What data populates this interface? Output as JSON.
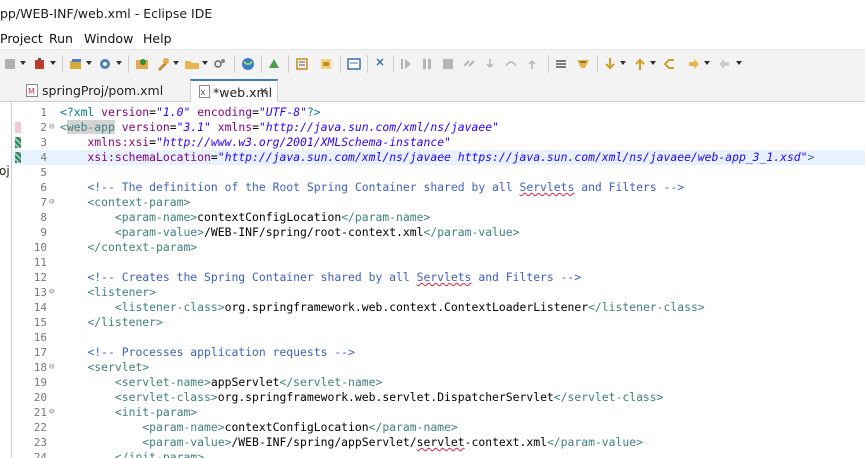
{
  "window": {
    "title": "pp/WEB-INF/web.xml - Eclipse IDE"
  },
  "menu": [
    {
      "label": "Project"
    },
    {
      "label": "Run"
    },
    {
      "label": "Window"
    },
    {
      "label": "Help"
    }
  ],
  "toolbar": {
    "icons": [
      "stop-icon",
      "debug-icon",
      "new-wizard-icon",
      "run-config-icon",
      "open-type-icon",
      "search-icon",
      "open-folder-icon",
      "tool-icon",
      "globe-icon",
      "run-server-icon",
      "outline-icon",
      "annotation-icon",
      "console-icon",
      "pin-icon",
      "resume-icon",
      "suspend-icon",
      "terminate-icon",
      "disconnect-icon",
      "step-into-icon",
      "step-over-icon",
      "step-return-icon",
      "task-list-icon",
      "bookmark-icon",
      "next-annotation-icon",
      "prev-annotation-icon",
      "back-icon",
      "forward-icon",
      "history-icon"
    ]
  },
  "tabs": [
    {
      "label": "springProj/pom.xml",
      "icon": "maven-pom-icon",
      "active": false
    },
    {
      "label": "*web.xml",
      "icon": "xml-file-icon",
      "active": true,
      "close": "✕"
    }
  ],
  "left_panel": {
    "fragment": "oj"
  },
  "editor": {
    "current_line": 4,
    "lines": [
      {
        "n": "1",
        "fold": "",
        "segments": [
          {
            "c": "k-pi",
            "t": "<?xml "
          },
          {
            "c": "k-attr",
            "t": "version"
          },
          {
            "c": "k-txt",
            "t": "="
          },
          {
            "c": "k-val",
            "t": "\"1.0\""
          },
          {
            "c": "k-txt",
            "t": " "
          },
          {
            "c": "k-attr",
            "t": "encoding"
          },
          {
            "c": "k-txt",
            "t": "="
          },
          {
            "c": "k-val",
            "t": "\"UTF-8\""
          },
          {
            "c": "k-pi",
            "t": "?>"
          }
        ]
      },
      {
        "n": "2",
        "fold": "⊖",
        "segments": [
          {
            "c": "k-tag",
            "t": "<"
          },
          {
            "c": "k-tag hl",
            "t": "web-app"
          },
          {
            "c": "k-txt",
            "t": " "
          },
          {
            "c": "k-attr",
            "t": "version"
          },
          {
            "c": "k-txt",
            "t": "="
          },
          {
            "c": "k-val",
            "t": "\"3.1\""
          },
          {
            "c": "k-txt",
            "t": " "
          },
          {
            "c": "k-attr",
            "t": "xmlns"
          },
          {
            "c": "k-txt",
            "t": "="
          },
          {
            "c": "k-val",
            "t": "\"http://java.sun.com/xml/ns/javaee\""
          }
        ]
      },
      {
        "n": "3",
        "fold": "",
        "segments": [
          {
            "c": "k-txt",
            "t": "    "
          },
          {
            "c": "k-attr",
            "t": "xmlns:xsi"
          },
          {
            "c": "k-txt",
            "t": "="
          },
          {
            "c": "k-val",
            "t": "\"http://www.w3.org/2001/XMLSchema-instance\""
          }
        ]
      },
      {
        "n": "4",
        "fold": "",
        "segments": [
          {
            "c": "k-txt",
            "t": "    "
          },
          {
            "c": "k-attr",
            "t": "xsi:schemaLocation"
          },
          {
            "c": "k-txt",
            "t": "="
          },
          {
            "c": "k-val",
            "t": "\"http://java.sun.com/xml/ns/javaee https://java.sun.com/xml/ns/javaee/web-app_3_1.xsd\""
          },
          {
            "c": "k-tag",
            "t": ">"
          }
        ]
      },
      {
        "n": "5",
        "fold": "",
        "segments": []
      },
      {
        "n": "6",
        "fold": "",
        "segments": [
          {
            "c": "k-txt",
            "t": "    "
          },
          {
            "c": "k-cmt",
            "t": "<!-- The definition of the Root Spring Container shared by all "
          },
          {
            "c": "k-cmt sq",
            "t": "Servlets"
          },
          {
            "c": "k-cmt",
            "t": " and Filters -->"
          }
        ]
      },
      {
        "n": "7",
        "fold": "⊖",
        "segments": [
          {
            "c": "k-txt",
            "t": "    "
          },
          {
            "c": "k-tag",
            "t": "<context-param>"
          }
        ]
      },
      {
        "n": "8",
        "fold": "",
        "segments": [
          {
            "c": "k-txt",
            "t": "        "
          },
          {
            "c": "k-tag",
            "t": "<param-name>"
          },
          {
            "c": "k-txt",
            "t": "contextConfigLocation"
          },
          {
            "c": "k-tag",
            "t": "</param-name>"
          }
        ]
      },
      {
        "n": "9",
        "fold": "",
        "segments": [
          {
            "c": "k-txt",
            "t": "        "
          },
          {
            "c": "k-tag",
            "t": "<param-value>"
          },
          {
            "c": "k-txt",
            "t": "/WEB-INF/spring/root-context.xml"
          },
          {
            "c": "k-tag",
            "t": "</param-value>"
          }
        ]
      },
      {
        "n": "10",
        "fold": "",
        "segments": [
          {
            "c": "k-txt",
            "t": "    "
          },
          {
            "c": "k-tag",
            "t": "</context-param>"
          }
        ]
      },
      {
        "n": "11",
        "fold": "",
        "segments": []
      },
      {
        "n": "12",
        "fold": "",
        "segments": [
          {
            "c": "k-txt",
            "t": "    "
          },
          {
            "c": "k-cmt",
            "t": "<!-- Creates the Spring Container shared by all "
          },
          {
            "c": "k-cmt sq",
            "t": "Servlets"
          },
          {
            "c": "k-cmt",
            "t": " and Filters -->"
          }
        ]
      },
      {
        "n": "13",
        "fold": "⊖",
        "segments": [
          {
            "c": "k-txt",
            "t": "    "
          },
          {
            "c": "k-tag",
            "t": "<listener>"
          }
        ]
      },
      {
        "n": "14",
        "fold": "",
        "segments": [
          {
            "c": "k-txt",
            "t": "        "
          },
          {
            "c": "k-tag",
            "t": "<listener-class>"
          },
          {
            "c": "k-txt",
            "t": "org.springframework.web.context.ContextLoaderListener"
          },
          {
            "c": "k-tag",
            "t": "</listener-class>"
          }
        ]
      },
      {
        "n": "15",
        "fold": "",
        "segments": [
          {
            "c": "k-txt",
            "t": "    "
          },
          {
            "c": "k-tag",
            "t": "</listener>"
          }
        ]
      },
      {
        "n": "16",
        "fold": "",
        "segments": []
      },
      {
        "n": "17",
        "fold": "",
        "segments": [
          {
            "c": "k-txt",
            "t": "    "
          },
          {
            "c": "k-cmt",
            "t": "<!-- Processes application requests -->"
          }
        ]
      },
      {
        "n": "18",
        "fold": "⊖",
        "segments": [
          {
            "c": "k-txt",
            "t": "    "
          },
          {
            "c": "k-tag",
            "t": "<servlet>"
          }
        ]
      },
      {
        "n": "19",
        "fold": "",
        "segments": [
          {
            "c": "k-txt",
            "t": "        "
          },
          {
            "c": "k-tag",
            "t": "<servlet-name>"
          },
          {
            "c": "k-txt",
            "t": "appServlet"
          },
          {
            "c": "k-tag",
            "t": "</servlet-name>"
          }
        ]
      },
      {
        "n": "20",
        "fold": "",
        "segments": [
          {
            "c": "k-txt",
            "t": "        "
          },
          {
            "c": "k-tag",
            "t": "<servlet-class>"
          },
          {
            "c": "k-txt",
            "t": "org.springframework.web.servlet.DispatcherServlet"
          },
          {
            "c": "k-tag",
            "t": "</servlet-class>"
          }
        ]
      },
      {
        "n": "21",
        "fold": "⊖",
        "segments": [
          {
            "c": "k-txt",
            "t": "        "
          },
          {
            "c": "k-tag",
            "t": "<init-param>"
          }
        ]
      },
      {
        "n": "22",
        "fold": "",
        "segments": [
          {
            "c": "k-txt",
            "t": "            "
          },
          {
            "c": "k-tag",
            "t": "<param-name>"
          },
          {
            "c": "k-txt",
            "t": "contextConfigLocation"
          },
          {
            "c": "k-tag",
            "t": "</param-name>"
          }
        ]
      },
      {
        "n": "23",
        "fold": "",
        "segments": [
          {
            "c": "k-txt",
            "t": "            "
          },
          {
            "c": "k-tag",
            "t": "<param-value>"
          },
          {
            "c": "k-txt",
            "t": "/WEB-INF/spring/appServlet/"
          },
          {
            "c": "k-txt sq",
            "t": "servlet"
          },
          {
            "c": "k-txt",
            "t": "-context.xml"
          },
          {
            "c": "k-tag",
            "t": "</param-value>"
          }
        ]
      },
      {
        "n": "24",
        "fold": "",
        "segments": [
          {
            "c": "k-txt",
            "t": "        "
          },
          {
            "c": "k-tag",
            "t": "</init-param>"
          }
        ]
      }
    ]
  },
  "colors": {
    "current_line": "#e8f2fe",
    "active_tab_accent": "#3c7fb1",
    "comment": "#3f5fbf",
    "tag": "#3f7f7f",
    "attribute": "#7f007f",
    "string": "#2a00ff"
  }
}
